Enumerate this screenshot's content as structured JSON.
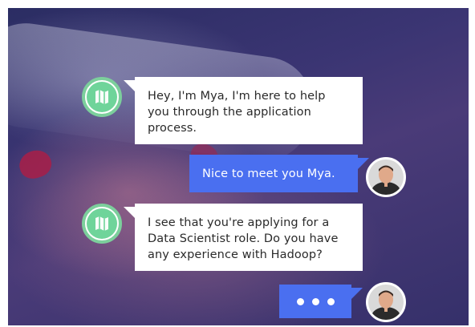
{
  "conversation": {
    "messages": [
      {
        "sender": "bot",
        "text": "Hey, I'm Mya, I'm here to help you through the application process."
      },
      {
        "sender": "user",
        "text": "Nice to meet you Mya."
      },
      {
        "sender": "bot",
        "text": "I see that you're applying for a Data Scientist role. Do you have any experience with Hadoop?"
      },
      {
        "sender": "user",
        "typing": true
      }
    ]
  },
  "theme": {
    "bot_bubble": "#ffffff",
    "user_bubble": "#4a6ff0",
    "bot_avatar_ring": "#7ccf9c",
    "bot_avatar_fill": "#6fd49a",
    "background": "#35306a"
  },
  "icons": {
    "bot_avatar": "mya-logo-icon",
    "user_avatar": "user-photo-icon"
  }
}
